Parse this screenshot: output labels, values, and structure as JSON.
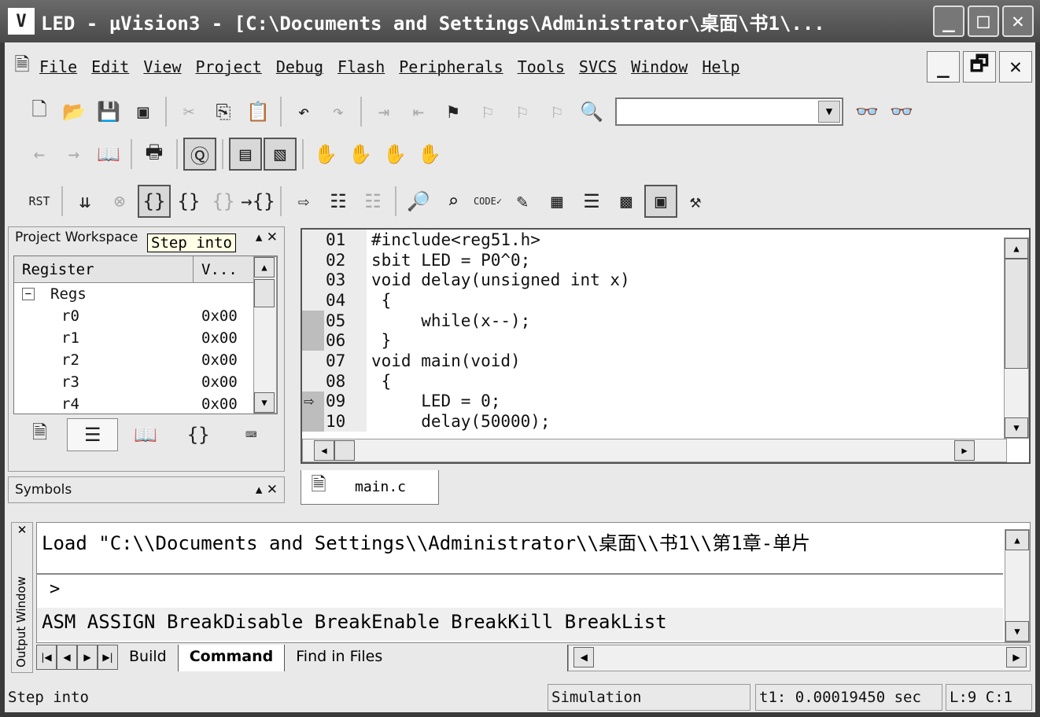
{
  "title_bar": {
    "title": "LED  - µVision3 - [C:\\Documents and Settings\\Administrator\\桌面\\书1\\...",
    "logo": "V"
  },
  "menu": {
    "items": [
      "File",
      "Edit",
      "View",
      "Project",
      "Debug",
      "Flash",
      "Peripherals",
      "Tools",
      "SVCS",
      "Window",
      "Help"
    ]
  },
  "toolbar": {
    "combo_value": ""
  },
  "tooltip": "Step into",
  "workspace": {
    "title": "Project Workspace",
    "columns": [
      "Register",
      "V..."
    ],
    "group": "Regs",
    "registers": [
      {
        "name": "r0",
        "value": "0x00"
      },
      {
        "name": "r1",
        "value": "0x00"
      },
      {
        "name": "r2",
        "value": "0x00"
      },
      {
        "name": "r3",
        "value": "0x00"
      },
      {
        "name": "r4",
        "value": "0x00"
      }
    ]
  },
  "symbols": {
    "title": "Symbols"
  },
  "editor": {
    "tab": "main.c",
    "current_line": "09",
    "lines": [
      {
        "n": "01",
        "code": "#include<reg51.h>"
      },
      {
        "n": "02",
        "code": "sbit LED = P0^0;"
      },
      {
        "n": "03",
        "code": "void delay(unsigned int x)"
      },
      {
        "n": "04",
        "code": " {"
      },
      {
        "n": "05",
        "code": "     while(x--);"
      },
      {
        "n": "06",
        "code": " }"
      },
      {
        "n": "07",
        "code": "void main(void)"
      },
      {
        "n": "08",
        "code": " {"
      },
      {
        "n": "09",
        "code": "     LED = 0;"
      },
      {
        "n": "10",
        "code": "     delay(50000);"
      }
    ]
  },
  "output": {
    "side_title": "Output Window",
    "load_line": "Load \"C:\\\\Documents and Settings\\\\Administrator\\\\桌面\\\\书1\\\\第1章-单片",
    "prompt": ">",
    "commands": "ASM ASSIGN BreakDisable BreakEnable BreakKill BreakList",
    "tabs": [
      "Build",
      "Command",
      "Find in Files"
    ],
    "active_tab": "Command"
  },
  "status": {
    "message": "Step into",
    "mode": "Simulation",
    "time": "t1: 0.00019450 sec",
    "position": "L:9 C:1"
  }
}
